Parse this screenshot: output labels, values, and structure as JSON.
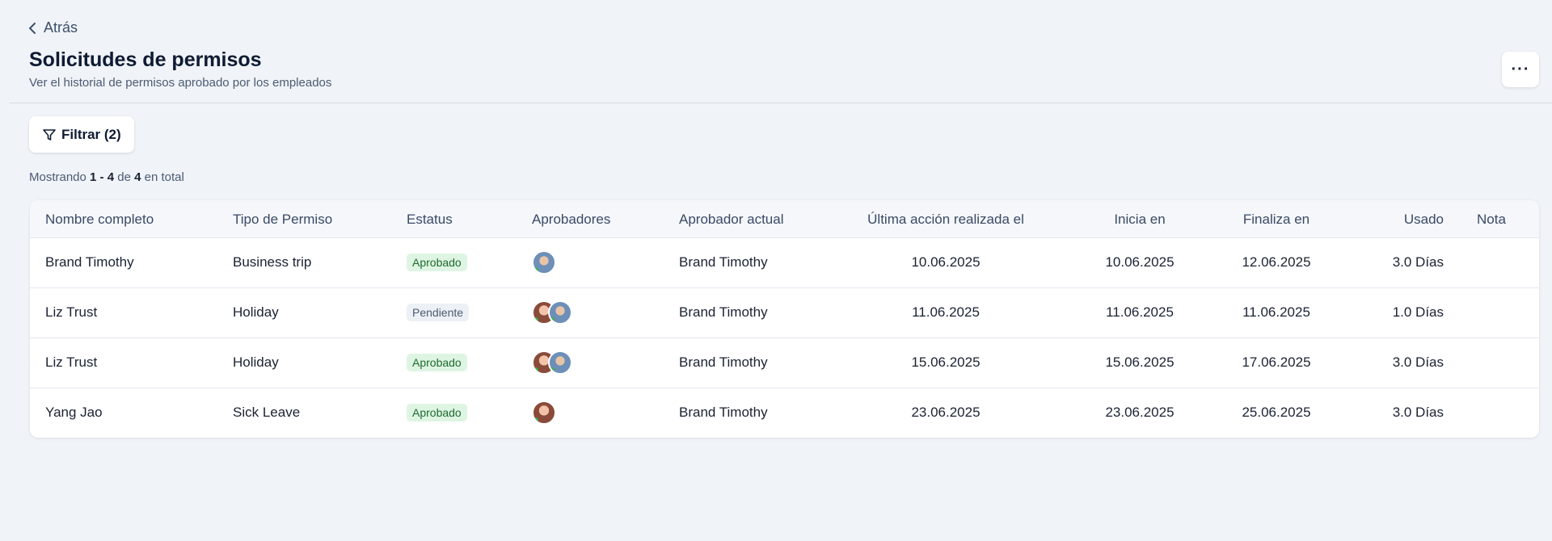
{
  "header": {
    "back_label": "Atrás",
    "title": "Solicitudes de permisos",
    "subtitle": "Ver el historial de permisos aprobado por los empleados",
    "more_label": "···"
  },
  "toolbar": {
    "filter_label": "Filtrar (2)"
  },
  "summary": {
    "prefix": "Mostrando",
    "range": "1 - 4",
    "of": "de",
    "total": "4",
    "suffix": "en total"
  },
  "table": {
    "columns": [
      "Nombre completo",
      "Tipo de Permiso",
      "Estatus",
      "Aprobadores",
      "Aprobador actual",
      "Última acción realizada el",
      "Inicia en",
      "Finaliza en",
      "Usado",
      "Nota"
    ],
    "rows": [
      {
        "name": "Brand Timothy",
        "type": "Business trip",
        "status": "Aprobado",
        "status_kind": "approved",
        "approvers": [
          "male"
        ],
        "current_approver": "Brand Timothy",
        "last_action": "10.06.2025",
        "start": "10.06.2025",
        "end": "12.06.2025",
        "used": "3.0 Días",
        "note": ""
      },
      {
        "name": "Liz Trust",
        "type": "Holiday",
        "status": "Pendiente",
        "status_kind": "pending",
        "approvers": [
          "female",
          "male"
        ],
        "current_approver": "Brand Timothy",
        "last_action": "11.06.2025",
        "start": "11.06.2025",
        "end": "11.06.2025",
        "used": "1.0 Días",
        "note": ""
      },
      {
        "name": "Liz Trust",
        "type": "Holiday",
        "status": "Aprobado",
        "status_kind": "approved",
        "approvers": [
          "female",
          "male"
        ],
        "current_approver": "Brand Timothy",
        "last_action": "15.06.2025",
        "start": "15.06.2025",
        "end": "17.06.2025",
        "used": "3.0 Días",
        "note": ""
      },
      {
        "name": "Yang Jao",
        "type": "Sick Leave",
        "status": "Aprobado",
        "status_kind": "approved",
        "approvers": [
          "female"
        ],
        "current_approver": "Brand Timothy",
        "last_action": "23.06.2025",
        "start": "23.06.2025",
        "end": "25.06.2025",
        "used": "3.0 Días",
        "note": ""
      }
    ]
  },
  "colors": {
    "background": "#f0f3f7",
    "approved_bg": "#dff5e3",
    "approved_text": "#1d6b2f",
    "pending_bg": "#edf0f5"
  }
}
